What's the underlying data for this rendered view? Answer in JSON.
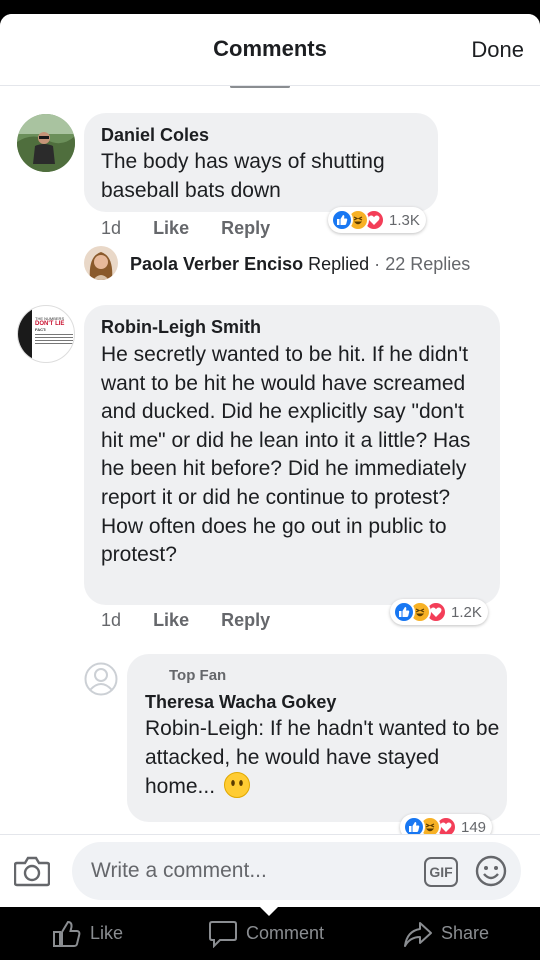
{
  "header": {
    "title": "Comments",
    "done_label": "Done"
  },
  "comments": [
    {
      "author": "Daniel Coles",
      "text": "The body has ways of shutting baseball bats down",
      "time": "1d",
      "like_label": "Like",
      "reply_label": "Reply",
      "reactions": {
        "types": [
          "like",
          "haha",
          "love"
        ],
        "count": "1.3K"
      },
      "replies_summary": {
        "author": "Paola Verber Enciso",
        "action": "Replied",
        "separator": "·",
        "count_text": "22 Replies"
      }
    },
    {
      "author": "Robin-Leigh Smith",
      "text": "He secretly wanted to be hit.  If he didn't want to be hit he would have screamed and ducked.  Did he explicitly say \"don't hit me\" or did he lean into it a little?  Has he been hit before?  Did he immediately report it or did he continue to protest?  How often does he go out in public to protest?",
      "time": "1d",
      "like_label": "Like",
      "reply_label": "Reply",
      "reactions": {
        "types": [
          "like",
          "haha",
          "love"
        ],
        "count": "1.2K"
      },
      "avatar_text": {
        "line1": "THE NUMBERS",
        "line2": "DON'T LIE",
        "line3": "FACT:"
      }
    }
  ],
  "reply": {
    "badge": "Top Fan",
    "author": "Theresa Wacha Gokey",
    "text": "Robin-Leigh:  If he hadn't wanted to be attacked, he would have stayed home...",
    "emoji": "face-without-mouth-emoji",
    "reactions": {
      "types": [
        "like",
        "haha",
        "love"
      ],
      "count": "149"
    }
  },
  "composer": {
    "placeholder": "Write a comment...",
    "gif_label": "GIF"
  },
  "actionbar": {
    "like_label": "Like",
    "comment_label": "Comment",
    "share_label": "Share"
  },
  "colors": {
    "accent": "#1877f2",
    "bubble": "#eff0f2",
    "love": "#f33e58",
    "haha": "#f7b125"
  }
}
